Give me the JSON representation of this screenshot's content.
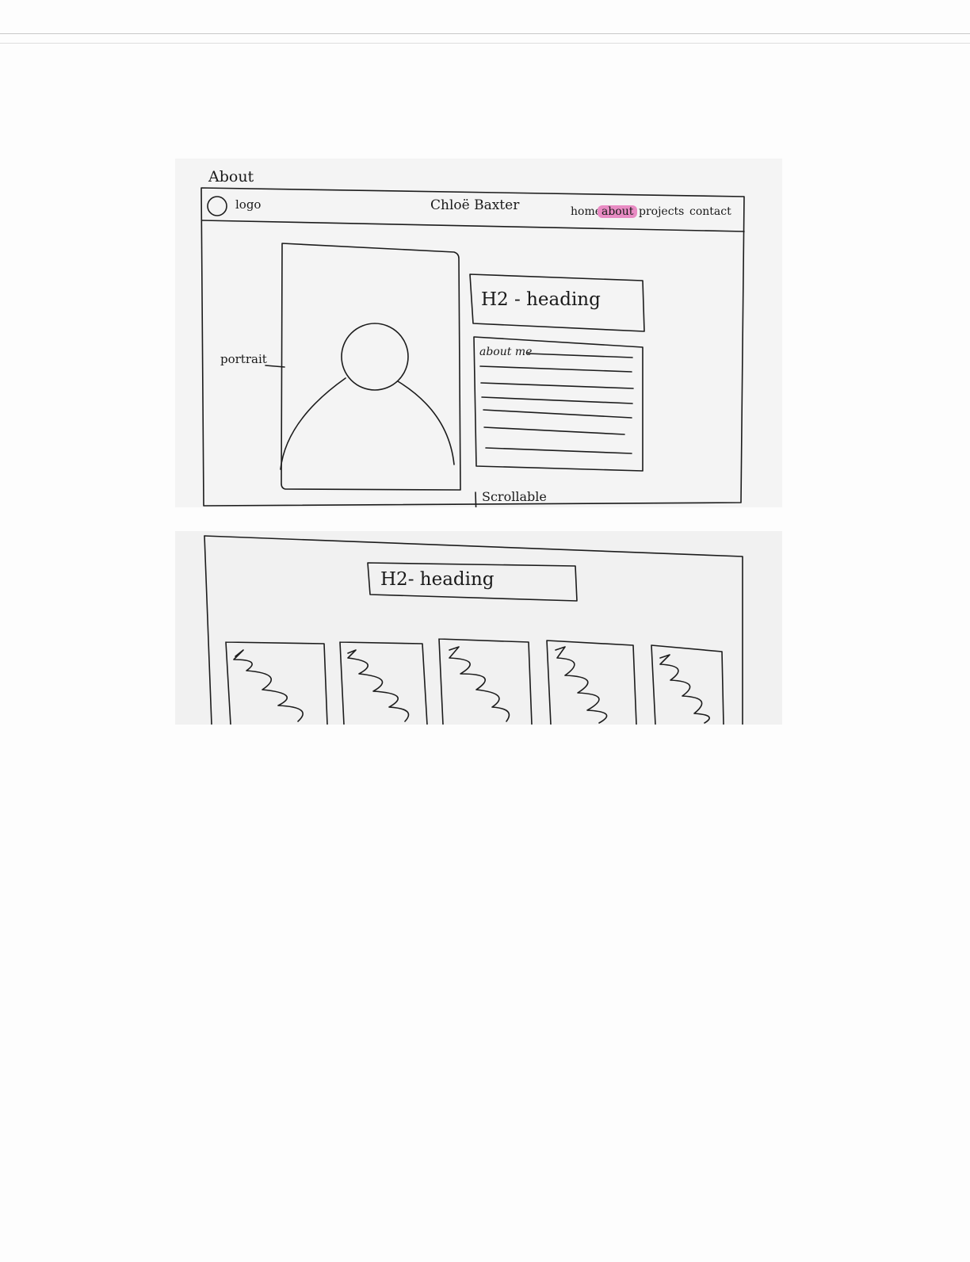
{
  "page_label": "About",
  "header": {
    "logo_text": "logo",
    "site_name": "Chloë Baxter",
    "nav": [
      {
        "label": "home"
      },
      {
        "label": "about",
        "active": true
      },
      {
        "label": "projects"
      },
      {
        "label": "contact"
      }
    ]
  },
  "about_section": {
    "portrait_label": "portrait",
    "heading": "H2 - heading",
    "about_text_label": "about me"
  },
  "scroll_label": "Scrollable",
  "projects_section": {
    "heading": "H2- heading",
    "thumbnail_count": 5
  },
  "colors": {
    "highlight": "#e88bc3",
    "ink": "#1c1c1c",
    "paper": "#f4f4f4"
  }
}
